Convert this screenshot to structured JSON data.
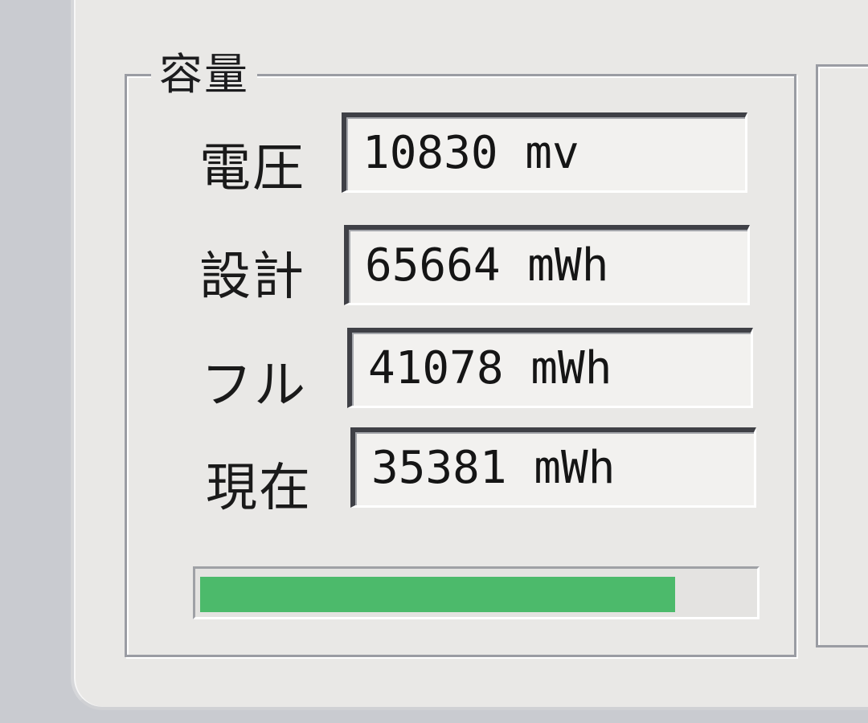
{
  "capacity_group": {
    "title": "容量",
    "rows": [
      {
        "label": "電圧",
        "value": "10830 mv"
      },
      {
        "label": "設計",
        "value": "65664 mWh"
      },
      {
        "label": "フル",
        "value": "41078 mWh"
      },
      {
        "label": "現在",
        "value": "35381 mWh"
      }
    ],
    "charge_level_fraction": 0.86
  },
  "colors": {
    "progress_fill": "#4cba6b",
    "window_background": "#e9e8e6"
  }
}
